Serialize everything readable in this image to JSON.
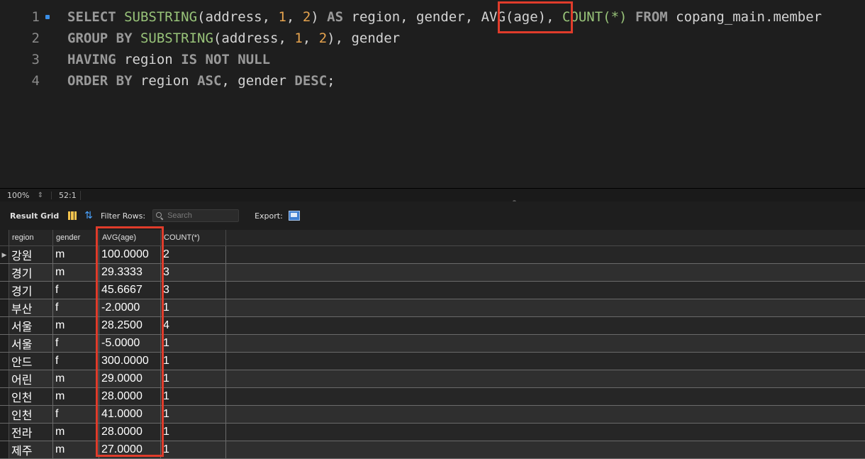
{
  "editor": {
    "lines": [
      {
        "n": "1"
      },
      {
        "n": "2"
      },
      {
        "n": "3"
      },
      {
        "n": "4"
      }
    ],
    "tokens": {
      "select": "SELECT",
      "substring": "SUBSTRING",
      "open_paren": "(",
      "address": "address",
      "comma_sp": ", ",
      "one": "1",
      "two": "2",
      "close_paren": ")",
      "as": "AS",
      "region": "region",
      "gender": "gender",
      "avg_age": "AVG(age)",
      "count_star": "COUNT(*)",
      "from": "FROM",
      "table": "copang_main.member",
      "group_by": "GROUP BY",
      "having": "HAVING",
      "is_not_null": "IS NOT NULL",
      "order_by": "ORDER BY",
      "asc": "ASC",
      "desc": "DESC",
      "semicolon": ";"
    }
  },
  "statusbar": {
    "zoom": "100%",
    "position": "52:1"
  },
  "toolbar": {
    "result_grid_label": "Result Grid",
    "filter_rows_label": "Filter Rows:",
    "search_placeholder": "Search",
    "export_label": "Export:"
  },
  "grid": {
    "columns": [
      "region",
      "gender",
      "AVG(age)",
      "COUNT(*)"
    ],
    "rows": [
      {
        "region": "강원",
        "gender": "m",
        "avg": "100.0000",
        "count": "2"
      },
      {
        "region": "경기",
        "gender": "m",
        "avg": "29.3333",
        "count": "3"
      },
      {
        "region": "경기",
        "gender": "f",
        "avg": "45.6667",
        "count": "3"
      },
      {
        "region": "부산",
        "gender": "f",
        "avg": "-2.0000",
        "count": "1"
      },
      {
        "region": "서울",
        "gender": "m",
        "avg": "28.2500",
        "count": "4"
      },
      {
        "region": "서울",
        "gender": "f",
        "avg": "-5.0000",
        "count": "1"
      },
      {
        "region": "안드",
        "gender": "f",
        "avg": "300.0000",
        "count": "1"
      },
      {
        "region": "어린",
        "gender": "m",
        "avg": "29.0000",
        "count": "1"
      },
      {
        "region": "인천",
        "gender": "m",
        "avg": "28.0000",
        "count": "1"
      },
      {
        "region": "인천",
        "gender": "f",
        "avg": "41.0000",
        "count": "1"
      },
      {
        "region": "전라",
        "gender": "m",
        "avg": "28.0000",
        "count": "1"
      },
      {
        "region": "제주",
        "gender": "m",
        "avg": "27.0000",
        "count": "1"
      }
    ]
  },
  "colors": {
    "highlight": "#e03c2b",
    "keyword": "#9a9a9a",
    "function": "#98c379",
    "number": "#e5a34e"
  }
}
